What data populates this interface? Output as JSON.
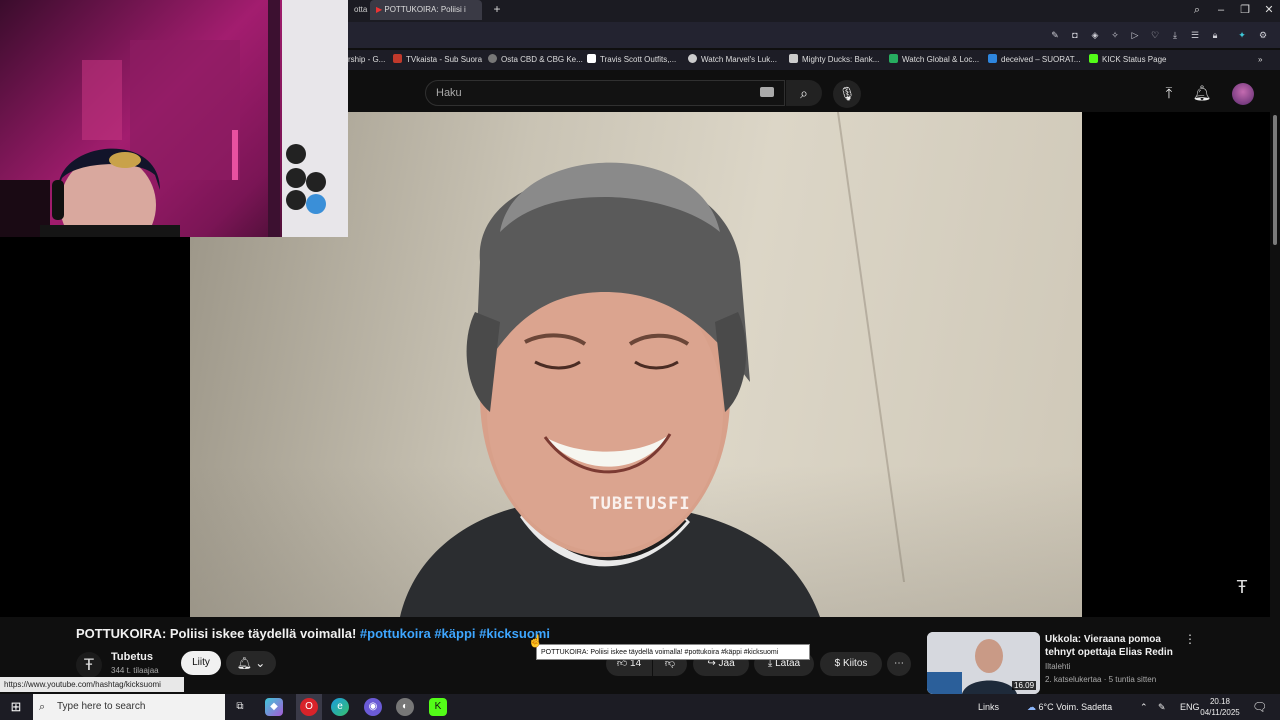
{
  "browser": {
    "tabs": [
      {
        "label": "otta"
      },
      {
        "label": "POTTUKOIRA: Poliisi i"
      }
    ],
    "bookmarks": [
      {
        "label": "rship - G...",
        "icon": "bookmark-icon",
        "color": "#888888"
      },
      {
        "label": "TVkaista - Sub Suora",
        "icon": "tvkaista-icon",
        "color": "#c0392b"
      },
      {
        "label": "Osta CBD & CBG Ke...",
        "icon": "cbd-icon",
        "color": "#777777"
      },
      {
        "label": "Travis Scott Outfits,...",
        "icon": "travis-icon",
        "color": "#ffffff"
      },
      {
        "label": "Watch Marvel's Luk...",
        "icon": "globe-icon",
        "color": "#cccccc"
      },
      {
        "label": "Mighty Ducks: Bank...",
        "icon": "duck-icon",
        "color": "#cccccc"
      },
      {
        "label": "Watch Global & Loc...",
        "icon": "watch-icon",
        "color": "#27ae60"
      },
      {
        "label": "deceived – SUORAT...",
        "icon": "suorat-icon",
        "color": "#2e86de"
      },
      {
        "label": "KICK Status Page",
        "icon": "kick-icon",
        "color": "#53fc18"
      }
    ]
  },
  "youtube": {
    "search_placeholder": "Haku",
    "video": {
      "watermark": "TUBETUSFI",
      "title_main": "POTTUKOIRA: Poliisi iskee täydellä voimalla! ",
      "hashtags": [
        "#pottukoira",
        " #käppi",
        " #kicksuomi"
      ],
      "channel": "Tubetus",
      "subscribers": "344 t. tilaajaa",
      "join_label": "Liity",
      "likes": "14",
      "share_label": "Jaa",
      "download_label": "Lataa",
      "thanks_label": "Kiitos"
    },
    "tooltip": "POTTUKOIRA: Poliisi iskee täydellä voimalla! #pottukoira #käppi #kicksuomi",
    "status_url": "https://www.youtube.com/hashtag/kicksuomi",
    "recommendation": {
      "title": "Ukkola: Vieraana pomoa tehnyt opettaja Elias Redin",
      "channel": "Iltalehti",
      "meta": "2. katselukertaa · 5 tuntia sitten",
      "duration": "16.09"
    }
  },
  "taskbar": {
    "search_placeholder": "Type here to search",
    "links_label": "Links",
    "weather": "6°C  Voim. Sadetta",
    "language": "ENG",
    "time": "20.18",
    "date": "04/11/2025"
  },
  "colors": {
    "youtube_bg": "#0f0f0f",
    "hashtag": "#3ea6ff",
    "webcam_wall": "#a31d6f"
  }
}
